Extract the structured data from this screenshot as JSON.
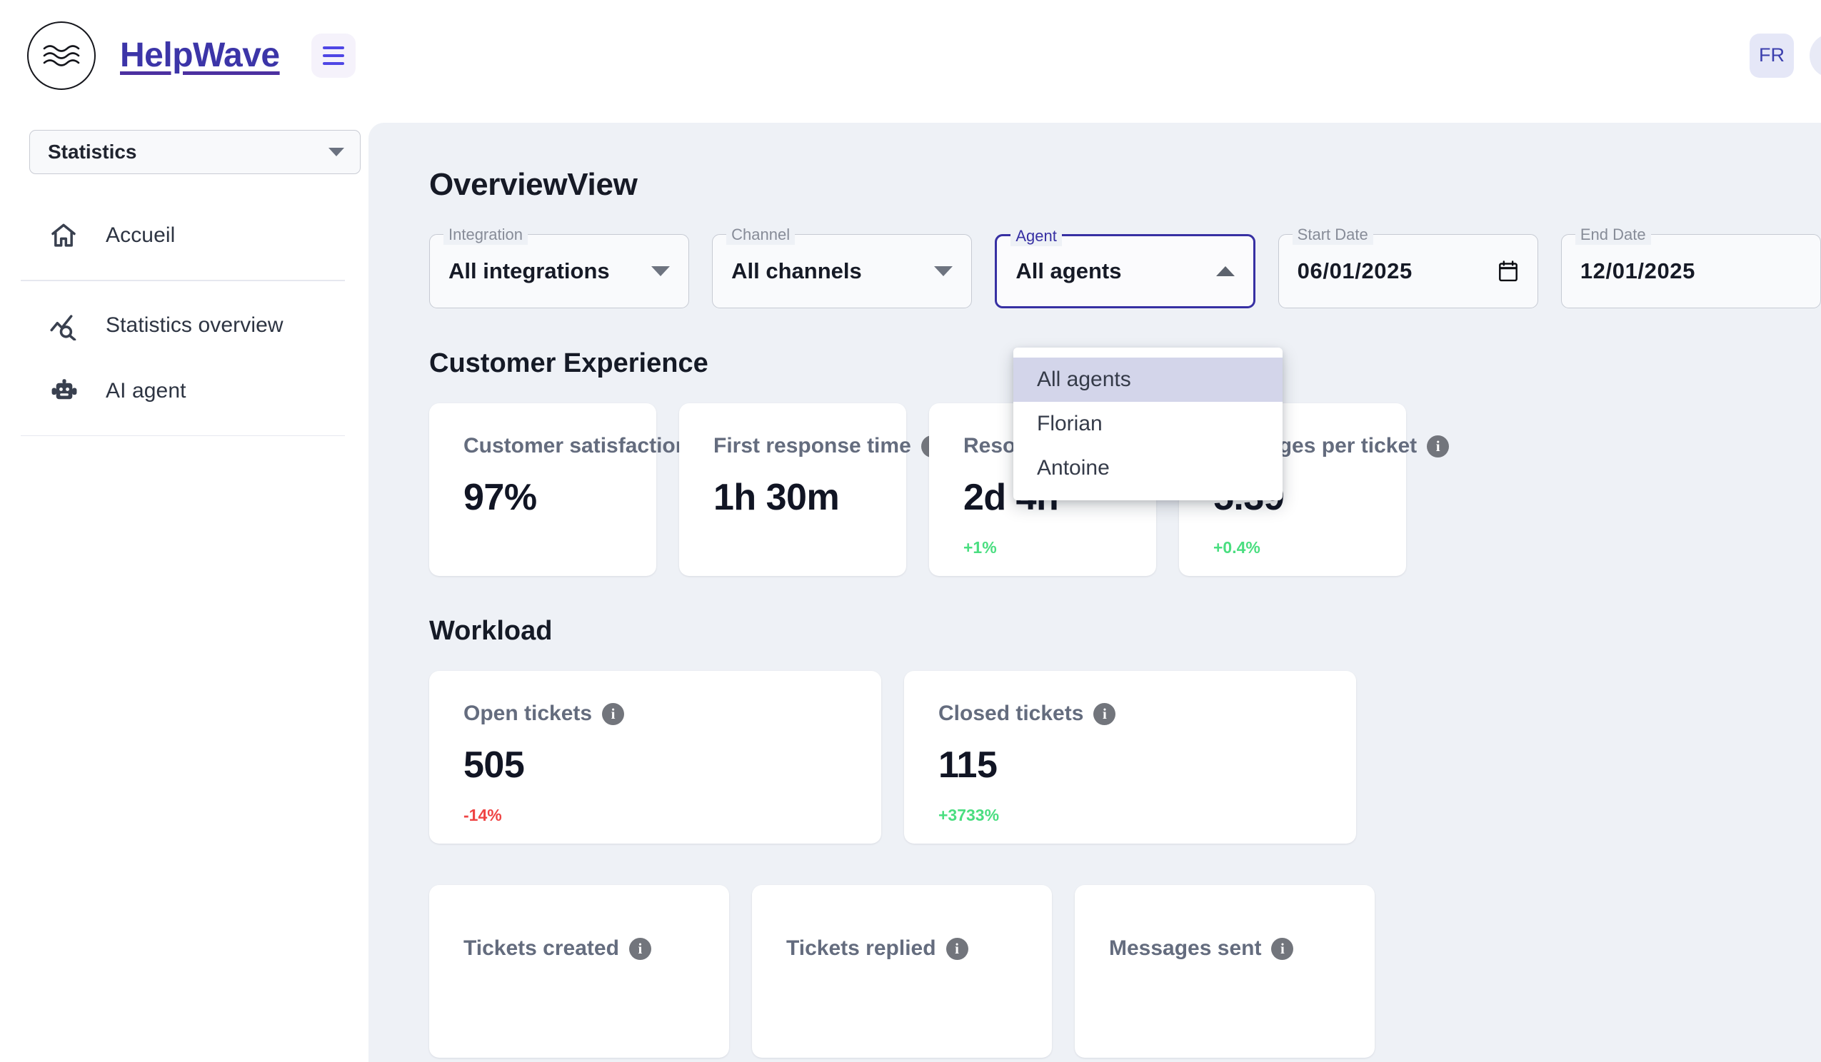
{
  "topbar": {
    "brand": "HelpWave",
    "logo_icon": "wave-circle-logo",
    "menu_icon": "hamburger-icon",
    "language": "FR",
    "avatar_icon": "user-avatar"
  },
  "sidebar": {
    "workspace_select": {
      "value": "Statistics",
      "icon": "chevron-down-icon"
    },
    "items": [
      {
        "label": "Accueil",
        "icon": "home-icon"
      },
      {
        "label": "Statistics overview",
        "icon": "chart-search-icon"
      },
      {
        "label": "AI agent",
        "icon": "robot-icon"
      }
    ]
  },
  "main": {
    "page_title": "OverviewView",
    "filters": [
      {
        "legend": "Integration",
        "value": "All integrations",
        "icon": "chevron-down-icon",
        "focused": false
      },
      {
        "legend": "Channel",
        "value": "All channels",
        "icon": "chevron-down-icon",
        "focused": false
      },
      {
        "legend": "Agent",
        "value": "All agents",
        "icon": "chevron-up-icon",
        "focused": true
      },
      {
        "legend": "Start Date",
        "value": "06/01/2025",
        "icon": "calendar-icon",
        "focused": false
      },
      {
        "legend": "End Date",
        "value": "12/01/2025",
        "icon": "calendar-icon",
        "focused": false
      }
    ],
    "agent_dropdown": {
      "open": true,
      "options": [
        "All agents",
        "Florian",
        "Antoine"
      ],
      "selected": "All agents"
    },
    "sections": [
      {
        "title": "Customer Experience",
        "cards": [
          {
            "label": "Customer satisfaction",
            "value": "97%",
            "delta": "",
            "delta_dir": ""
          },
          {
            "label": "First response time",
            "value": "1h 30m",
            "delta": "",
            "delta_dir": ""
          },
          {
            "label": "Resolution time",
            "value": "2d 4h",
            "delta": "+1%",
            "delta_dir": "up"
          },
          {
            "label": "Messages per ticket",
            "value": "5.39",
            "delta": "+0.4%",
            "delta_dir": "up"
          }
        ]
      },
      {
        "title": "Workload",
        "cards": [
          {
            "label": "Open tickets",
            "value": "505",
            "delta": "-14%",
            "delta_dir": "down"
          },
          {
            "label": "Closed tickets",
            "value": "115",
            "delta": "+3733%",
            "delta_dir": "up"
          }
        ]
      },
      {
        "title": "",
        "cards": [
          {
            "label": "Tickets created",
            "value": "",
            "delta": "",
            "delta_dir": ""
          },
          {
            "label": "Tickets replied",
            "value": "",
            "delta": "",
            "delta_dir": ""
          },
          {
            "label": "Messages sent",
            "value": "",
            "delta": "",
            "delta_dir": ""
          }
        ]
      }
    ]
  },
  "colors": {
    "brand": "#3c35a8",
    "accent": "#4f46e5",
    "focus_border": "#3730a3",
    "positive": "#4ade80",
    "negative": "#ef4444",
    "canvas": "#eef1f6"
  }
}
